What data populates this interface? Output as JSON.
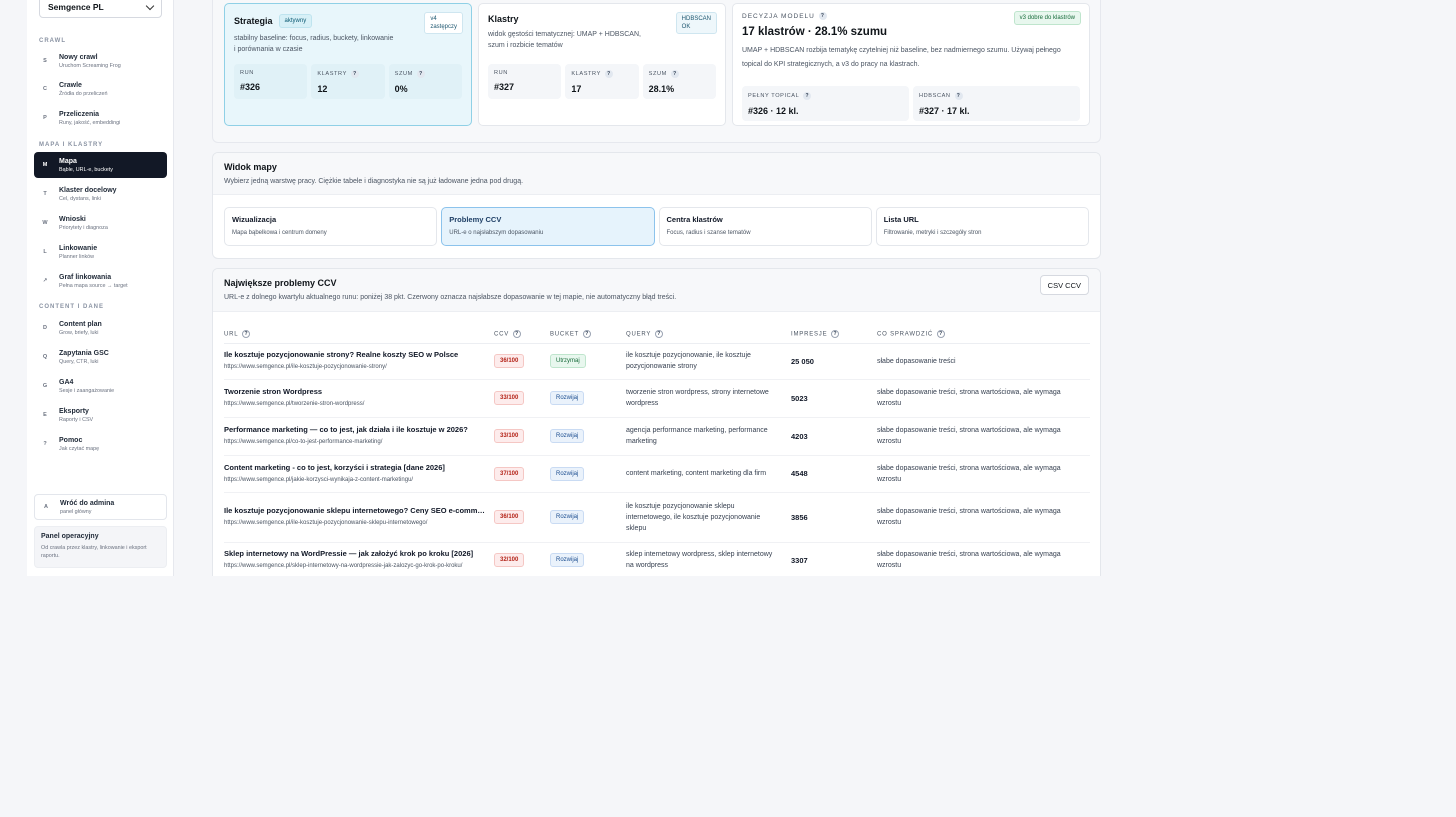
{
  "sidebar": {
    "workspace": "Semgence PL",
    "sections": {
      "crawl": "CRAWL",
      "map": "MAPA I KLASTRY",
      "content": "CONTENT I DANE"
    },
    "items": [
      {
        "icon": "S",
        "label": "Nowy crawl",
        "sub": "Uruchom Screaming Frog"
      },
      {
        "icon": "C",
        "label": "Crawle",
        "sub": "Źródła do przeliczeń"
      },
      {
        "icon": "P",
        "label": "Przeliczenia",
        "sub": "Runy, jakość, embeddingi"
      },
      {
        "icon": "M",
        "label": "Mapa",
        "sub": "Bąble, URL-e, buckety"
      },
      {
        "icon": "T",
        "label": "Klaster docelowy",
        "sub": "Cel, dystans, linki"
      },
      {
        "icon": "W",
        "label": "Wnioski",
        "sub": "Priorytety i diagnoza"
      },
      {
        "icon": "L",
        "label": "Linkowanie",
        "sub": "Planner linków"
      },
      {
        "icon": "↗",
        "label": "Graf linkowania",
        "sub": "Pełna mapa source → target"
      },
      {
        "icon": "D",
        "label": "Content plan",
        "sub": "Grow, briefy, luki"
      },
      {
        "icon": "Q",
        "label": "Zapytania GSC",
        "sub": "Query, CTR, luki"
      },
      {
        "icon": "G",
        "label": "GA4",
        "sub": "Sesje i zaangażowanie"
      },
      {
        "icon": "E",
        "label": "Eksporty",
        "sub": "Raporty i CSV"
      },
      {
        "icon": "?",
        "label": "Pomoc",
        "sub": "Jak czytać mapę"
      }
    ],
    "back": {
      "icon": "A",
      "label": "Wróć do admina",
      "sub": "panel główny"
    },
    "ops": {
      "title": "Panel operacyjny",
      "desc": "Od crawla przez klastry, linkowanie i eksport raportu."
    }
  },
  "modes": [
    {
      "title": "Strategia",
      "status": "aktywny",
      "corner": "v4\nzastępczy",
      "desc": "stabilny baseline: focus, radius, buckety, linkowanie i porównania w czasie",
      "stats": [
        {
          "k": "RUN",
          "v": "#326"
        },
        {
          "k": "KLASTRY",
          "v": "12"
        },
        {
          "k": "SZUM",
          "v": "0%"
        }
      ]
    },
    {
      "title": "Klastry",
      "corner": "HDBSCAN\nOK",
      "desc": "widok gęstości tematycznej: UMAP + HDBSCAN, szum i rozbicie tematów",
      "stats": [
        {
          "k": "RUN",
          "v": "#327"
        },
        {
          "k": "KLASTRY",
          "v": "17"
        },
        {
          "k": "SZUM",
          "v": "28.1%"
        }
      ]
    }
  ],
  "decision": {
    "label": "DECYZJA MODELU",
    "badge": "v3 dobre do klastrów",
    "title": "17 klastrów · 28.1% szumu",
    "desc": "UMAP + HDBSCAN rozbija tematykę czytelniej niż baseline, bez nadmiernego szumu. Używaj pełnego topical do KPI strategicznych, a v3 do pracy na klastrach.",
    "stats": [
      {
        "k": "PEŁNY TOPICAL",
        "v": "#326 · 12 kl."
      },
      {
        "k": "HDBSCAN",
        "v": "#327 · 17 kl."
      }
    ]
  },
  "map_view": {
    "title": "Widok mapy",
    "subtitle": "Wybierz jedną warstwę pracy. Ciężkie tabele i diagnostyka nie są już ładowane jedna pod drugą.",
    "tabs": [
      {
        "label": "Wizualizacja",
        "sub": "Mapa bąbelkowa i centrum domeny"
      },
      {
        "label": "Problemy CCV",
        "sub": "URL-e o najsłabszym dopasowaniu"
      },
      {
        "label": "Centra klastrów",
        "sub": "Focus, radius i szanse tematów"
      },
      {
        "label": "Lista URL",
        "sub": "Filtrowanie, metryki i szczegóły stron"
      }
    ]
  },
  "problems": {
    "title": "Największe problemy CCV",
    "subtitle": "URL-e z dolnego kwartylu aktualnego runu: poniżej 38 pkt. Czerwony oznacza najsłabsze dopasowanie w tej mapie, nie automatyczny błąd treści.",
    "csv_label": "CSV CCV",
    "columns": [
      "URL",
      "CCV",
      "BUCKET",
      "QUERY",
      "IMPRESJE",
      "CO SPRAWDZIĆ"
    ],
    "rows": [
      {
        "title": "Ile kosztuje pozycjonowanie strony? Realne koszty SEO w Polsce",
        "url": "https://www.semgence.pl/ile-kosztuje-pozycjonowanie-strony/",
        "ccv": "36/100",
        "bucket": "Utrzymaj",
        "query": "ile kosztuje pozycjonowanie, ile kosztuje pozycjonowanie strony",
        "impressions": "25 050",
        "check": "słabe dopasowanie treści"
      },
      {
        "title": "Tworzenie stron Wordpress",
        "url": "https://www.semgence.pl/tworzenie-stron-wordpress/",
        "ccv": "33/100",
        "bucket": "Rozwijaj",
        "query": "tworzenie stron wordpress, strony internetowe wordpress",
        "impressions": "5023",
        "check": "słabe dopasowanie treści, strona wartościowa, ale wymaga wzrostu"
      },
      {
        "title": "Performance marketing — co to jest, jak działa i ile kosztuje w 2026?",
        "url": "https://www.semgence.pl/co-to-jest-performance-marketing/",
        "ccv": "33/100",
        "bucket": "Rozwijaj",
        "query": "agencja performance marketing, performance marketing",
        "impressions": "4203",
        "check": "słabe dopasowanie treści, strona wartościowa, ale wymaga wzrostu"
      },
      {
        "title": "Content marketing - co to jest, korzyści i strategia [dane 2026]",
        "url": "https://www.semgence.pl/jakie-korzysci-wynikaja-z-content-marketingu/",
        "ccv": "37/100",
        "bucket": "Rozwijaj",
        "query": "content marketing, content marketing dla firm",
        "impressions": "4548",
        "check": "słabe dopasowanie treści, strona wartościowa, ale wymaga wzrostu"
      },
      {
        "title": "Ile kosztuje pozycjonowanie sklepu internetowego? Ceny SEO e-commerce",
        "url": "https://www.semgence.pl/ile-kosztuje-pozycjonowanie-sklepu-internetowego/",
        "ccv": "36/100",
        "bucket": "Rozwijaj",
        "query": "ile kosztuje pozycjonowanie sklepu internetowego, ile kosztuje pozycjonowanie sklepu",
        "impressions": "3856",
        "check": "słabe dopasowanie treści, strona wartościowa, ale wymaga wzrostu"
      },
      {
        "title": "Sklep internetowy na WordPressie — jak założyć krok po kroku [2026]",
        "url": "https://www.semgence.pl/sklep-internetowy-na-wordpressie-jak-zalozyc-go-krok-po-kroku/",
        "ccv": "32/100",
        "bucket": "Rozwijaj",
        "query": "sklep internetowy wordpress, sklep internetowy na wordpress",
        "impressions": "3307",
        "check": "słabe dopasowanie treści, strona wartościowa, ale wymaga wzrostu"
      }
    ]
  },
  "colors": {
    "accent_dark": "#121826",
    "selected_bg": "#e8f6fb",
    "danger": "#b42318",
    "success": "#176b3a"
  }
}
